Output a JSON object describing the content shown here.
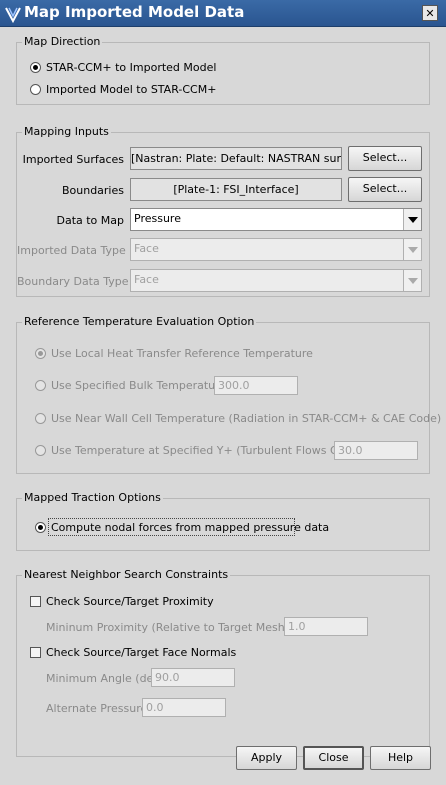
{
  "window": {
    "title": "Map Imported Model Data",
    "close_glyph": "✕"
  },
  "map_direction": {
    "legend": "Map Direction",
    "options": [
      "STAR-CCM+ to Imported Model",
      "Imported Model to STAR-CCM+"
    ],
    "selected_index": 0
  },
  "mapping_inputs": {
    "legend": "Mapping Inputs",
    "imported_surfaces": {
      "label": "Imported Surfaces",
      "value": "[Nastran: Plate: Default: NASTRAN surface]",
      "button": "Select..."
    },
    "boundaries": {
      "label": "Boundaries",
      "value": "[Plate-1: FSI_Interface]",
      "button": "Select..."
    },
    "data_to_map": {
      "label": "Data to Map",
      "value": "Pressure"
    },
    "imported_data_type": {
      "label": "Imported Data Type",
      "value": "Face"
    },
    "boundary_data_type": {
      "label": "Boundary Data Type",
      "value": "Face"
    }
  },
  "reference_temperature": {
    "legend": "Reference Temperature Evaluation Option",
    "options": [
      "Use Local Heat Transfer Reference Temperature",
      "Use Specified Bulk Temperature",
      "Use Near Wall Cell Temperature (Radiation in STAR-CCM+ & CAE Code)",
      "Use Temperature at Specified Y+ (Turbulent Flows Only)"
    ],
    "selected_index": 0,
    "bulk_temperature": "300.0",
    "y_plus": "30.0"
  },
  "mapped_traction": {
    "legend": "Mapped Traction Options",
    "option": "Compute nodal forces from mapped pressure data",
    "selected": true
  },
  "nearest_neighbor": {
    "legend": "Nearest Neighbor Search Constraints",
    "check_proximity": {
      "label": "Check Source/Target Proximity",
      "checked": false
    },
    "minimum_proximity": {
      "label": "Mininum Proximity (Relative to Target Mesh Size)",
      "value": "1.0"
    },
    "check_face_normals": {
      "label": "Check Source/Target Face Normals",
      "checked": false
    },
    "minimum_angle": {
      "label": "Minimum Angle (deg)",
      "value": "90.0"
    },
    "alternate_pressure": {
      "label": "Alternate Pressure",
      "value": "0.0"
    }
  },
  "buttons": {
    "apply": "Apply",
    "close": "Close",
    "help": "Help"
  },
  "icons": {
    "app": "star-ccm-app-icon",
    "dropdown": "chevron-down-icon"
  }
}
